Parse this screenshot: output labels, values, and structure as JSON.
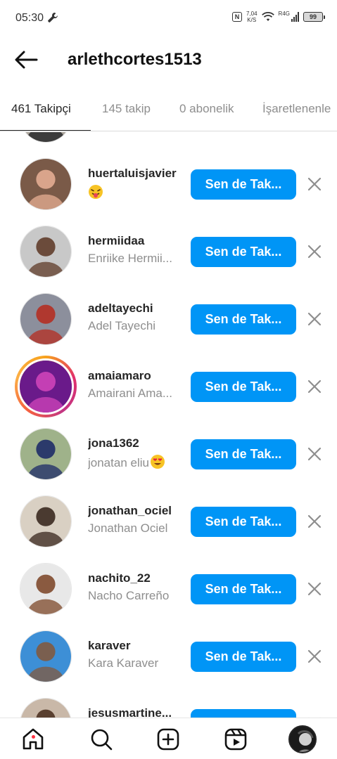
{
  "status_bar": {
    "time": "05:30",
    "net_speed_value": "7,04",
    "net_speed_unit": "K/S",
    "network_type": "R4G",
    "battery": "99"
  },
  "header": {
    "title": "arlethcortes1513",
    "back_icon": "arrow-left-icon"
  },
  "tabs": [
    {
      "label": "461 Takipçi",
      "active": true
    },
    {
      "label": "145 takip",
      "active": false
    },
    {
      "label": "0 abonelik",
      "active": false
    },
    {
      "label": "İşaretlenenle",
      "active": false
    }
  ],
  "followers": [
    {
      "username": "huertaluisjavier",
      "fullname": "",
      "emoji": "face-with-tongue-icon",
      "button": "Sen de Tak...",
      "story": false,
      "colors": [
        "#7a5a48",
        "#d9a48b"
      ]
    },
    {
      "username": "hermiidaa",
      "fullname": "Enriike Hermii...",
      "button": "Sen de Tak...",
      "story": false,
      "colors": [
        "#c8c8c8",
        "#6b4b3b"
      ]
    },
    {
      "username": "adeltayechi",
      "fullname": "Adel Tayechi",
      "button": "Sen de Tak...",
      "story": false,
      "colors": [
        "#8c8f9c",
        "#b0382f"
      ]
    },
    {
      "username": "amaiamaro",
      "fullname": "Amairani Ama...",
      "button": "Sen de Tak...",
      "story": true,
      "colors": [
        "#6a1a8a",
        "#c43fb4"
      ]
    },
    {
      "username": "jona1362",
      "fullname": "jonatan eliu",
      "emoji_after": "heart-eyes-icon",
      "button": "Sen de Tak...",
      "story": false,
      "colors": [
        "#9fb28a",
        "#2b3a6b"
      ]
    },
    {
      "username": "jonathan_ociel",
      "fullname": "Jonathan Ociel",
      "button": "Sen de Tak...",
      "story": false,
      "colors": [
        "#d9d0c3",
        "#4a3a30"
      ]
    },
    {
      "username": "nachito_22",
      "fullname": "Nacho Carreño",
      "button": "Sen de Tak...",
      "story": false,
      "colors": [
        "#e8e8e8",
        "#8a5a40"
      ]
    },
    {
      "username": "karaver",
      "fullname": "Kara Karaver",
      "button": "Sen de Tak...",
      "story": false,
      "colors": [
        "#3d8fd6",
        "#7a5f4f"
      ]
    },
    {
      "username": "jesusmartine...",
      "fullname": "",
      "button": "Sen de Tak...",
      "story": false,
      "colors": [
        "#c9b8a8",
        "#5a4030"
      ]
    }
  ],
  "bottom_nav": [
    {
      "icon": "home-icon",
      "active": true
    },
    {
      "icon": "search-icon",
      "active": false
    },
    {
      "icon": "create-plus-icon",
      "active": false
    },
    {
      "icon": "reels-icon",
      "active": false
    },
    {
      "icon": "profile-avatar-icon",
      "active": false
    }
  ],
  "colors": {
    "accent": "#0095f6",
    "text": "#262626",
    "secondary": "#8e8e8e"
  }
}
